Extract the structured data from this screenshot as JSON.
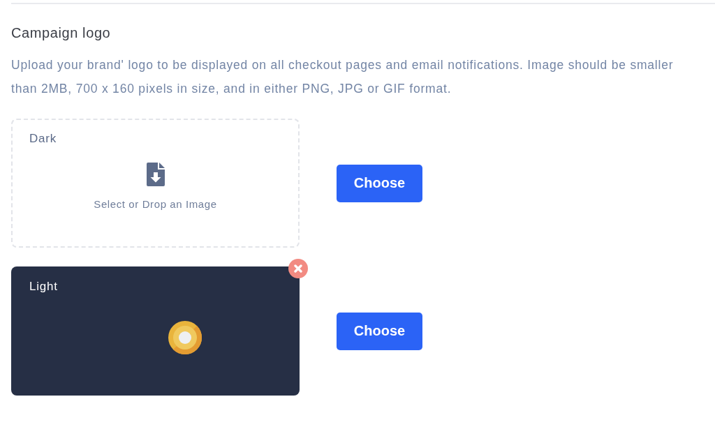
{
  "section": {
    "title": "Campaign logo",
    "description": "Upload your brand' logo to be displayed on all checkout pages and email notifications. Image should be smaller than 2MB, 700 x 160 pixels in size, and in either PNG, JPG or GIF format.",
    "uploads": [
      {
        "kind": "empty",
        "label": "Dark",
        "prompt": "Select or Drop an Image",
        "button": "Choose"
      },
      {
        "kind": "filled",
        "label": "Light",
        "button": "Choose"
      }
    ]
  }
}
